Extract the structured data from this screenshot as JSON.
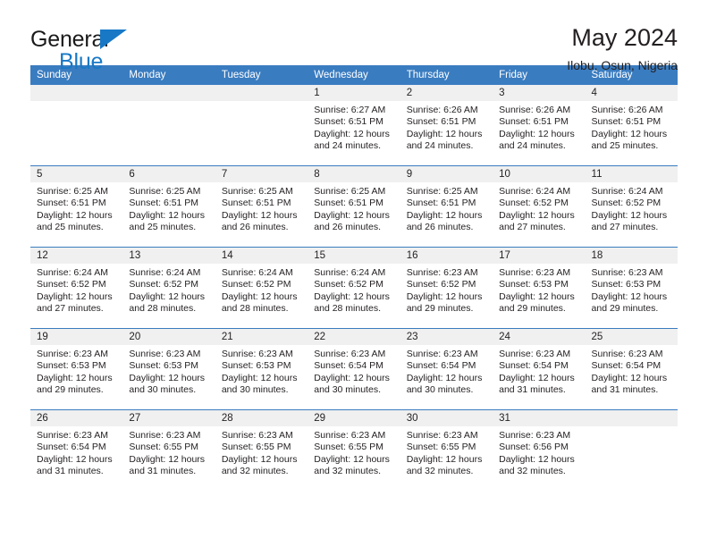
{
  "brand": {
    "line1": "General",
    "line2": "Blue",
    "flag_color": "#1878c6"
  },
  "header": {
    "title": "May 2024",
    "subtitle": "Ilobu, Osun, Nigeria"
  },
  "theme": {
    "header_blue": "#3a7cc0",
    "daynum_band": "#f0f0f0",
    "text": "#231f20"
  },
  "weekday_headers": [
    "Sunday",
    "Monday",
    "Tuesday",
    "Wednesday",
    "Thursday",
    "Friday",
    "Saturday"
  ],
  "weeks": [
    [
      {
        "day": "",
        "empty": true,
        "sunrise": "",
        "sunset": "",
        "daylight1": "",
        "daylight2": ""
      },
      {
        "day": "",
        "empty": true,
        "sunrise": "",
        "sunset": "",
        "daylight1": "",
        "daylight2": ""
      },
      {
        "day": "",
        "empty": true,
        "sunrise": "",
        "sunset": "",
        "daylight1": "",
        "daylight2": ""
      },
      {
        "day": "1",
        "empty": false,
        "sunrise": "Sunrise: 6:27 AM",
        "sunset": "Sunset: 6:51 PM",
        "daylight1": "Daylight: 12 hours",
        "daylight2": "and 24 minutes."
      },
      {
        "day": "2",
        "empty": false,
        "sunrise": "Sunrise: 6:26 AM",
        "sunset": "Sunset: 6:51 PM",
        "daylight1": "Daylight: 12 hours",
        "daylight2": "and 24 minutes."
      },
      {
        "day": "3",
        "empty": false,
        "sunrise": "Sunrise: 6:26 AM",
        "sunset": "Sunset: 6:51 PM",
        "daylight1": "Daylight: 12 hours",
        "daylight2": "and 24 minutes."
      },
      {
        "day": "4",
        "empty": false,
        "sunrise": "Sunrise: 6:26 AM",
        "sunset": "Sunset: 6:51 PM",
        "daylight1": "Daylight: 12 hours",
        "daylight2": "and 25 minutes."
      }
    ],
    [
      {
        "day": "5",
        "empty": false,
        "sunrise": "Sunrise: 6:25 AM",
        "sunset": "Sunset: 6:51 PM",
        "daylight1": "Daylight: 12 hours",
        "daylight2": "and 25 minutes."
      },
      {
        "day": "6",
        "empty": false,
        "sunrise": "Sunrise: 6:25 AM",
        "sunset": "Sunset: 6:51 PM",
        "daylight1": "Daylight: 12 hours",
        "daylight2": "and 25 minutes."
      },
      {
        "day": "7",
        "empty": false,
        "sunrise": "Sunrise: 6:25 AM",
        "sunset": "Sunset: 6:51 PM",
        "daylight1": "Daylight: 12 hours",
        "daylight2": "and 26 minutes."
      },
      {
        "day": "8",
        "empty": false,
        "sunrise": "Sunrise: 6:25 AM",
        "sunset": "Sunset: 6:51 PM",
        "daylight1": "Daylight: 12 hours",
        "daylight2": "and 26 minutes."
      },
      {
        "day": "9",
        "empty": false,
        "sunrise": "Sunrise: 6:25 AM",
        "sunset": "Sunset: 6:51 PM",
        "daylight1": "Daylight: 12 hours",
        "daylight2": "and 26 minutes."
      },
      {
        "day": "10",
        "empty": false,
        "sunrise": "Sunrise: 6:24 AM",
        "sunset": "Sunset: 6:52 PM",
        "daylight1": "Daylight: 12 hours",
        "daylight2": "and 27 minutes."
      },
      {
        "day": "11",
        "empty": false,
        "sunrise": "Sunrise: 6:24 AM",
        "sunset": "Sunset: 6:52 PM",
        "daylight1": "Daylight: 12 hours",
        "daylight2": "and 27 minutes."
      }
    ],
    [
      {
        "day": "12",
        "empty": false,
        "sunrise": "Sunrise: 6:24 AM",
        "sunset": "Sunset: 6:52 PM",
        "daylight1": "Daylight: 12 hours",
        "daylight2": "and 27 minutes."
      },
      {
        "day": "13",
        "empty": false,
        "sunrise": "Sunrise: 6:24 AM",
        "sunset": "Sunset: 6:52 PM",
        "daylight1": "Daylight: 12 hours",
        "daylight2": "and 28 minutes."
      },
      {
        "day": "14",
        "empty": false,
        "sunrise": "Sunrise: 6:24 AM",
        "sunset": "Sunset: 6:52 PM",
        "daylight1": "Daylight: 12 hours",
        "daylight2": "and 28 minutes."
      },
      {
        "day": "15",
        "empty": false,
        "sunrise": "Sunrise: 6:24 AM",
        "sunset": "Sunset: 6:52 PM",
        "daylight1": "Daylight: 12 hours",
        "daylight2": "and 28 minutes."
      },
      {
        "day": "16",
        "empty": false,
        "sunrise": "Sunrise: 6:23 AM",
        "sunset": "Sunset: 6:52 PM",
        "daylight1": "Daylight: 12 hours",
        "daylight2": "and 29 minutes."
      },
      {
        "day": "17",
        "empty": false,
        "sunrise": "Sunrise: 6:23 AM",
        "sunset": "Sunset: 6:53 PM",
        "daylight1": "Daylight: 12 hours",
        "daylight2": "and 29 minutes."
      },
      {
        "day": "18",
        "empty": false,
        "sunrise": "Sunrise: 6:23 AM",
        "sunset": "Sunset: 6:53 PM",
        "daylight1": "Daylight: 12 hours",
        "daylight2": "and 29 minutes."
      }
    ],
    [
      {
        "day": "19",
        "empty": false,
        "sunrise": "Sunrise: 6:23 AM",
        "sunset": "Sunset: 6:53 PM",
        "daylight1": "Daylight: 12 hours",
        "daylight2": "and 29 minutes."
      },
      {
        "day": "20",
        "empty": false,
        "sunrise": "Sunrise: 6:23 AM",
        "sunset": "Sunset: 6:53 PM",
        "daylight1": "Daylight: 12 hours",
        "daylight2": "and 30 minutes."
      },
      {
        "day": "21",
        "empty": false,
        "sunrise": "Sunrise: 6:23 AM",
        "sunset": "Sunset: 6:53 PM",
        "daylight1": "Daylight: 12 hours",
        "daylight2": "and 30 minutes."
      },
      {
        "day": "22",
        "empty": false,
        "sunrise": "Sunrise: 6:23 AM",
        "sunset": "Sunset: 6:54 PM",
        "daylight1": "Daylight: 12 hours",
        "daylight2": "and 30 minutes."
      },
      {
        "day": "23",
        "empty": false,
        "sunrise": "Sunrise: 6:23 AM",
        "sunset": "Sunset: 6:54 PM",
        "daylight1": "Daylight: 12 hours",
        "daylight2": "and 30 minutes."
      },
      {
        "day": "24",
        "empty": false,
        "sunrise": "Sunrise: 6:23 AM",
        "sunset": "Sunset: 6:54 PM",
        "daylight1": "Daylight: 12 hours",
        "daylight2": "and 31 minutes."
      },
      {
        "day": "25",
        "empty": false,
        "sunrise": "Sunrise: 6:23 AM",
        "sunset": "Sunset: 6:54 PM",
        "daylight1": "Daylight: 12 hours",
        "daylight2": "and 31 minutes."
      }
    ],
    [
      {
        "day": "26",
        "empty": false,
        "sunrise": "Sunrise: 6:23 AM",
        "sunset": "Sunset: 6:54 PM",
        "daylight1": "Daylight: 12 hours",
        "daylight2": "and 31 minutes."
      },
      {
        "day": "27",
        "empty": false,
        "sunrise": "Sunrise: 6:23 AM",
        "sunset": "Sunset: 6:55 PM",
        "daylight1": "Daylight: 12 hours",
        "daylight2": "and 31 minutes."
      },
      {
        "day": "28",
        "empty": false,
        "sunrise": "Sunrise: 6:23 AM",
        "sunset": "Sunset: 6:55 PM",
        "daylight1": "Daylight: 12 hours",
        "daylight2": "and 32 minutes."
      },
      {
        "day": "29",
        "empty": false,
        "sunrise": "Sunrise: 6:23 AM",
        "sunset": "Sunset: 6:55 PM",
        "daylight1": "Daylight: 12 hours",
        "daylight2": "and 32 minutes."
      },
      {
        "day": "30",
        "empty": false,
        "sunrise": "Sunrise: 6:23 AM",
        "sunset": "Sunset: 6:55 PM",
        "daylight1": "Daylight: 12 hours",
        "daylight2": "and 32 minutes."
      },
      {
        "day": "31",
        "empty": false,
        "sunrise": "Sunrise: 6:23 AM",
        "sunset": "Sunset: 6:56 PM",
        "daylight1": "Daylight: 12 hours",
        "daylight2": "and 32 minutes."
      },
      {
        "day": "",
        "empty": true,
        "sunrise": "",
        "sunset": "",
        "daylight1": "",
        "daylight2": ""
      }
    ]
  ]
}
